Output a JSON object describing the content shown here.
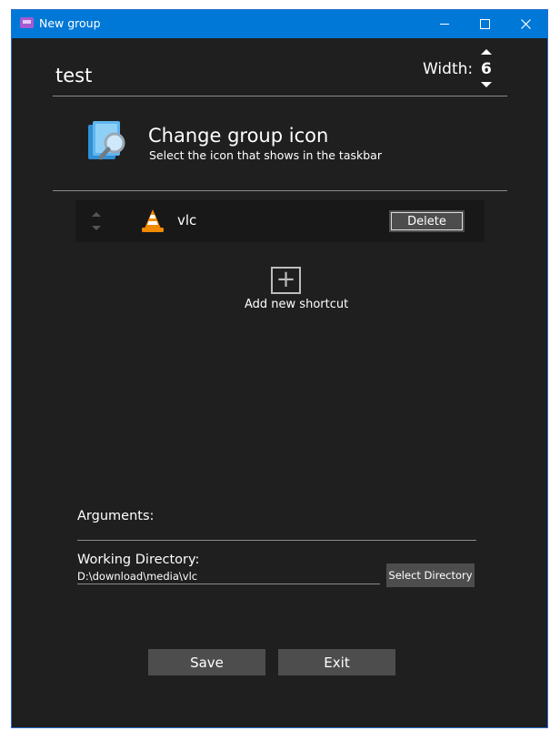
{
  "titlebar": {
    "title": "New group",
    "app_icon": "app-icon",
    "minimize_icon": "minimize-icon",
    "maximize_icon": "maximize-icon",
    "close_icon": "close-icon",
    "accent": "#0078d7"
  },
  "group": {
    "name": "test",
    "width_label": "Width:",
    "width_value": "6"
  },
  "icon_section": {
    "title": "Change group icon",
    "subtitle": "Select the icon that shows in the taskbar",
    "icon": "group-icon"
  },
  "shortcuts": [
    {
      "name": "vlc",
      "icon": "vlc-icon",
      "delete_label": "Delete"
    }
  ],
  "add_shortcut": {
    "label": "Add new shortcut",
    "icon": "plus-icon"
  },
  "details": {
    "arguments_label": "Arguments:",
    "arguments_value": "",
    "working_dir_label": "Working Directory:",
    "working_dir_value": "D:\\download\\media\\vlc",
    "select_dir_label": "Select Directory"
  },
  "footer": {
    "save_label": "Save",
    "exit_label": "Exit"
  },
  "colors": {
    "background": "#1f1f1f",
    "button": "#4d4d4d",
    "row": "#181818",
    "text": "#ffffff"
  }
}
